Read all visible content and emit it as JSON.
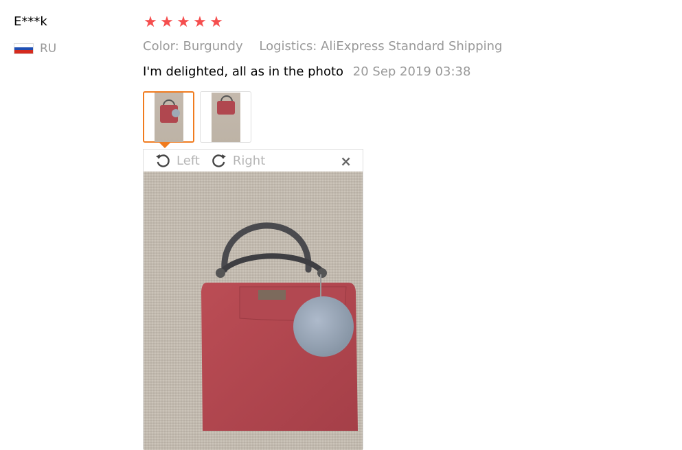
{
  "reviewer": {
    "name": "E***k",
    "country_code": "RU",
    "flag_icon": "russia-flag-icon"
  },
  "rating": {
    "stars": 5,
    "star_symbol": "★",
    "color": "#f54e4e"
  },
  "meta": {
    "color": "Color: Burgundy",
    "logistics": "Logistics: AliExpress Standard Shipping"
  },
  "review": {
    "text": "I'm delighted, all as in the photo",
    "date": "20 Sep 2019 03:38"
  },
  "thumbnails": [
    {
      "icon": "bag-thumbnail",
      "active": true
    },
    {
      "icon": "bag-thumbnail",
      "active": false
    }
  ],
  "viewer": {
    "rotate_left_label": "Left",
    "rotate_right_label": "Right",
    "close_symbol": "×"
  },
  "colors": {
    "accent": "#f07b1e",
    "muted_text": "#999999",
    "bag": "#b0474f",
    "pompom": "#9eaab7",
    "background_photo": "#c5bdb1"
  }
}
